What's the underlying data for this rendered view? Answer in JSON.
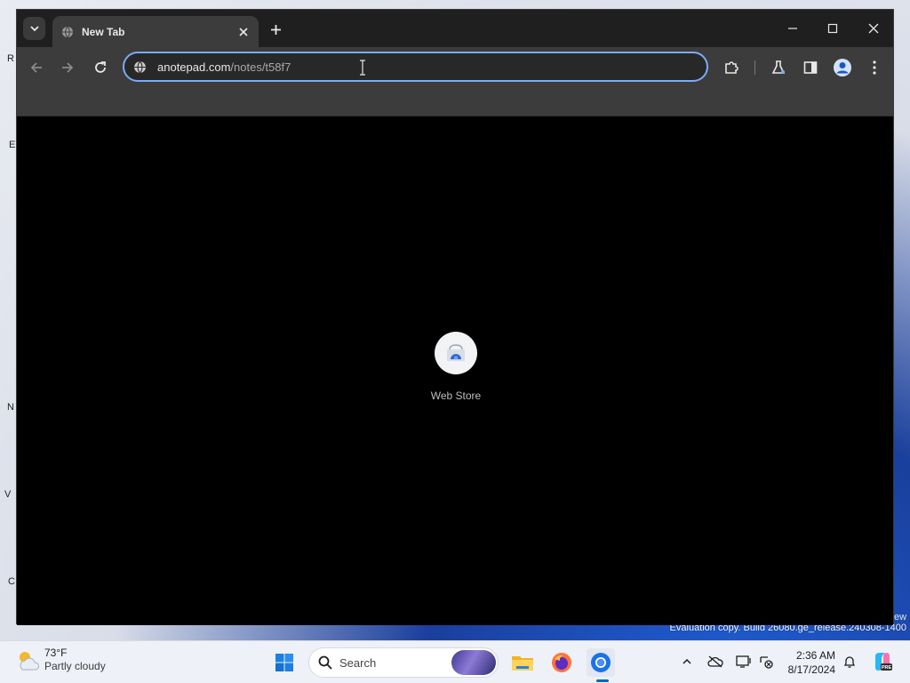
{
  "desktop": {
    "watermark": "Evaluation copy. Build 26080.ge_release.240308-1400",
    "edge_fragments": [
      "R",
      "E",
      "N",
      "V",
      "C"
    ],
    "right_fragment": "ew"
  },
  "browser": {
    "tab": {
      "title": "New Tab",
      "favicon": "globe-icon"
    },
    "address_bar": {
      "domain": "anotepad.com",
      "path": "/notes/t58f7"
    },
    "toolbar_icons": [
      "back-icon",
      "forward-icon",
      "reload-icon",
      "extensions-icon",
      "labs-icon",
      "side-panel-icon",
      "profile-icon",
      "menu-icon"
    ],
    "shortcuts": [
      {
        "label": "Web Store",
        "icon": "web-store-icon"
      }
    ]
  },
  "taskbar": {
    "weather": {
      "temp": "73°F",
      "desc": "Partly cloudy"
    },
    "search_placeholder": "Search",
    "pinned_icons": [
      "windows-start-icon",
      "file-explorer-icon",
      "firefox-icon",
      "chrome-icon"
    ],
    "tray_icons": [
      "chevron-up-icon",
      "cloud-offline-icon",
      "display-icon",
      "network-icon",
      "notification-bell-icon",
      "copilot-icon"
    ],
    "clock": {
      "time": "2:36 AM",
      "date": "8/17/2024"
    }
  },
  "colors": {
    "omnibox_focus": "#7cacf8",
    "accent": "#0067c0",
    "chrome_dark": "#3c3c3c"
  }
}
